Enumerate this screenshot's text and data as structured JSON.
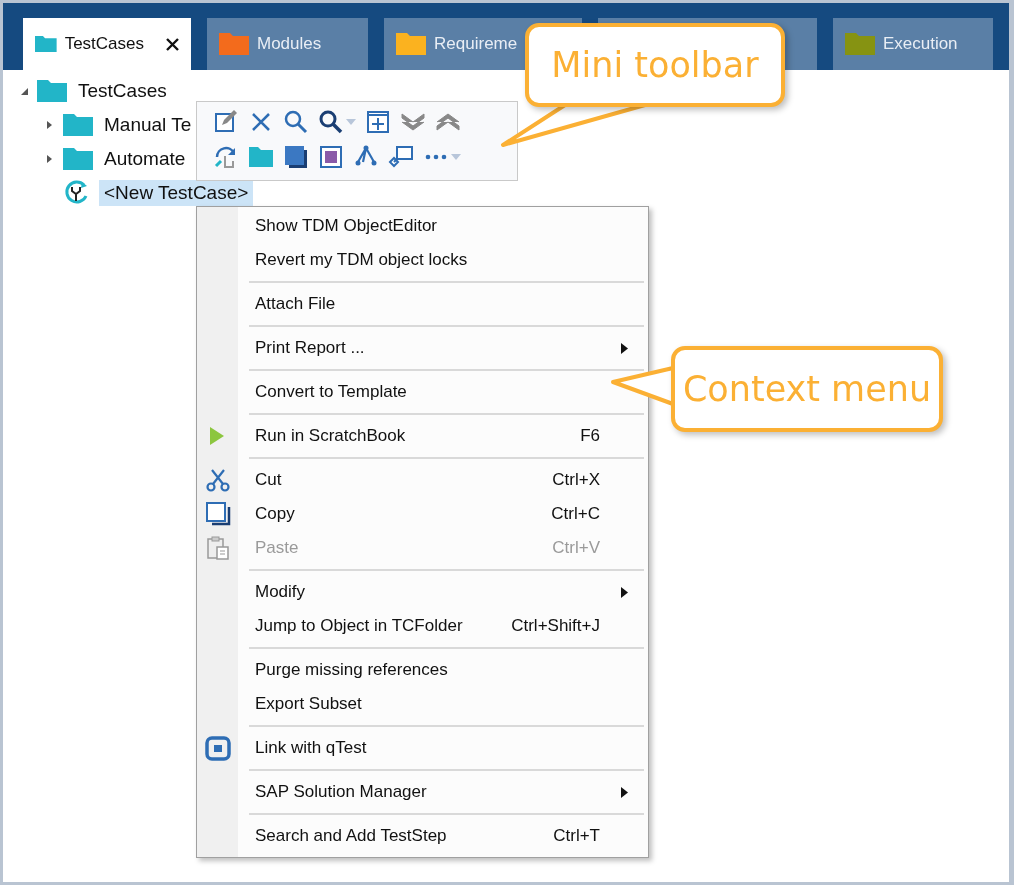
{
  "tabs": [
    {
      "label": "TestCases",
      "color": "#22b5c8",
      "selected": true,
      "closable": true
    },
    {
      "label": "Modules",
      "color": "#f36b1c",
      "selected": false,
      "closable": false
    },
    {
      "label": "Requireme",
      "color": "#fbb21f",
      "selected": false,
      "closable": false
    },
    {
      "selected": false
    },
    {
      "label": "Execution",
      "color": "#869312",
      "selected": false,
      "closable": false
    }
  ],
  "tree": [
    {
      "label": "TestCases",
      "kind": "folder",
      "expanded": true,
      "selected": false,
      "children": [
        {
          "label": "Manual Te",
          "kind": "folder",
          "expanded": false,
          "selected": false
        },
        {
          "label": "Automate",
          "kind": "folder",
          "expanded": false,
          "selected": false
        },
        {
          "label": "<New TestCase>",
          "kind": "testcase",
          "selected": true
        }
      ]
    }
  ],
  "mini_toolbar": [
    [
      {
        "kind": "edit",
        "dropdown": false
      },
      {
        "kind": "delete",
        "dropdown": false
      },
      {
        "kind": "search",
        "dropdown": false
      },
      {
        "kind": "search-bold",
        "dropdown": true
      },
      {
        "kind": "add",
        "dropdown": false
      },
      {
        "kind": "expand",
        "dropdown": false
      },
      {
        "kind": "collapse",
        "dropdown": false
      }
    ],
    [
      {
        "kind": "sync",
        "dropdown": false
      },
      {
        "kind": "folder",
        "dropdown": false
      },
      {
        "kind": "square",
        "dropdown": false
      },
      {
        "kind": "frame",
        "dropdown": false
      },
      {
        "kind": "tree",
        "dropdown": false
      },
      {
        "kind": "link",
        "dropdown": false
      },
      {
        "kind": "more",
        "dropdown": true
      }
    ]
  ],
  "context_menu": [
    [
      {
        "label": "Show TDM ObjectEditor",
        "kind": "plain",
        "disabled": false,
        "submenu": false
      },
      {
        "label": "Revert my TDM object locks",
        "kind": "plain",
        "disabled": false,
        "submenu": false
      }
    ],
    [
      {
        "label": "Attach File",
        "kind": "plain",
        "disabled": false,
        "submenu": false
      }
    ],
    [
      {
        "label": "Print Report ...",
        "kind": "plain",
        "disabled": false,
        "submenu": true
      }
    ],
    [
      {
        "label": "Convert to Template",
        "kind": "plain",
        "disabled": false,
        "submenu": false
      }
    ],
    [
      {
        "label": "Run in ScratchBook",
        "shortcut": "F6",
        "kind": "run",
        "disabled": false,
        "submenu": false
      }
    ],
    [
      {
        "label": "Cut",
        "shortcut": "Ctrl+X",
        "kind": "cut",
        "disabled": false,
        "submenu": false
      },
      {
        "label": "Copy",
        "shortcut": "Ctrl+C",
        "kind": "copy",
        "disabled": false,
        "submenu": false
      },
      {
        "label": "Paste",
        "shortcut": "Ctrl+V",
        "kind": "paste",
        "disabled": true,
        "submenu": false
      }
    ],
    [
      {
        "label": "Modify",
        "kind": "plain",
        "disabled": false,
        "submenu": true
      },
      {
        "label": "Jump to Object in TCFolder",
        "shortcut": "Ctrl+Shift+J",
        "kind": "plain",
        "disabled": false,
        "submenu": false
      }
    ],
    [
      {
        "label": "Purge missing references",
        "kind": "plain",
        "disabled": false,
        "submenu": false
      },
      {
        "label": "Export Subset",
        "kind": "plain",
        "disabled": false,
        "submenu": false
      }
    ],
    [
      {
        "label": "Link with qTest",
        "kind": "qtest",
        "disabled": false,
        "submenu": false
      }
    ],
    [
      {
        "label": "SAP Solution Manager",
        "kind": "plain",
        "disabled": false,
        "submenu": true
      }
    ],
    [
      {
        "label": "Search and Add TestStep",
        "shortcut": "Ctrl+T",
        "kind": "plain",
        "disabled": false,
        "submenu": false
      }
    ]
  ],
  "callouts": [
    {
      "text": "Mini toolbar",
      "kind": "toolbar"
    },
    {
      "text": "Context menu",
      "kind": "menu"
    }
  ]
}
